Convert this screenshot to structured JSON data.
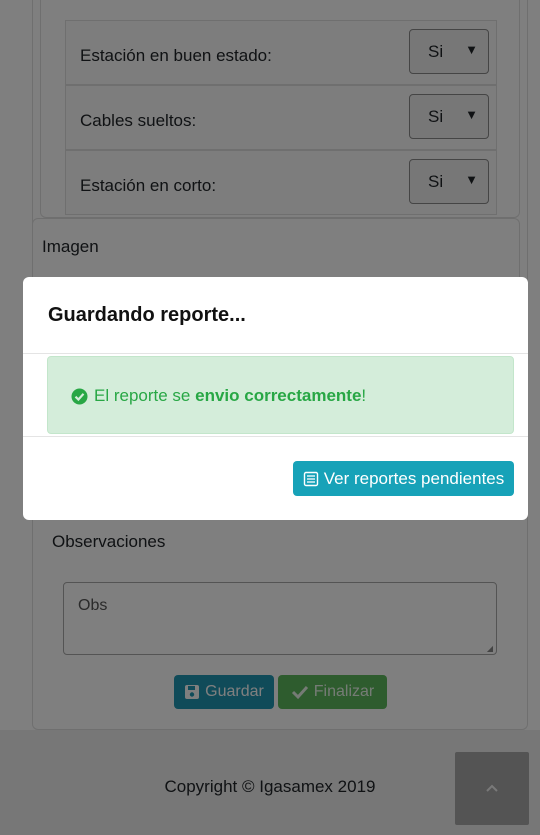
{
  "form": {
    "checks": [
      {
        "label": "Estación en buen estado:",
        "value": "Si"
      },
      {
        "label": "Cables sueltos:",
        "value": "Si"
      },
      {
        "label": "Estación en corto:",
        "value": "Si"
      }
    ],
    "image_heading": "Imagen",
    "observations_heading": "Observaciones",
    "observations_placeholder": "Obs",
    "save_label": "Guardar",
    "finish_label": "Finalizar"
  },
  "footer": {
    "copyright": "Copyright © Igasamex 2019"
  },
  "modal": {
    "title": "Guardando reporte...",
    "alert_prefix": "El reporte se ",
    "alert_strong": "envio correctamente",
    "alert_suffix": "!",
    "pending_button": "Ver reportes pendientes"
  },
  "colors": {
    "alert_green": "#28a745",
    "alert_bg": "#d4edda",
    "info_button": "#17a2b8",
    "save_button": "#2196b3",
    "finish_button": "#5cb85c"
  },
  "icons": {
    "alert": "check-circle-icon",
    "pending": "list-icon",
    "save": "floppy-disk-icon",
    "finish": "checkmark-icon",
    "to_top": "chevron-up-icon"
  }
}
